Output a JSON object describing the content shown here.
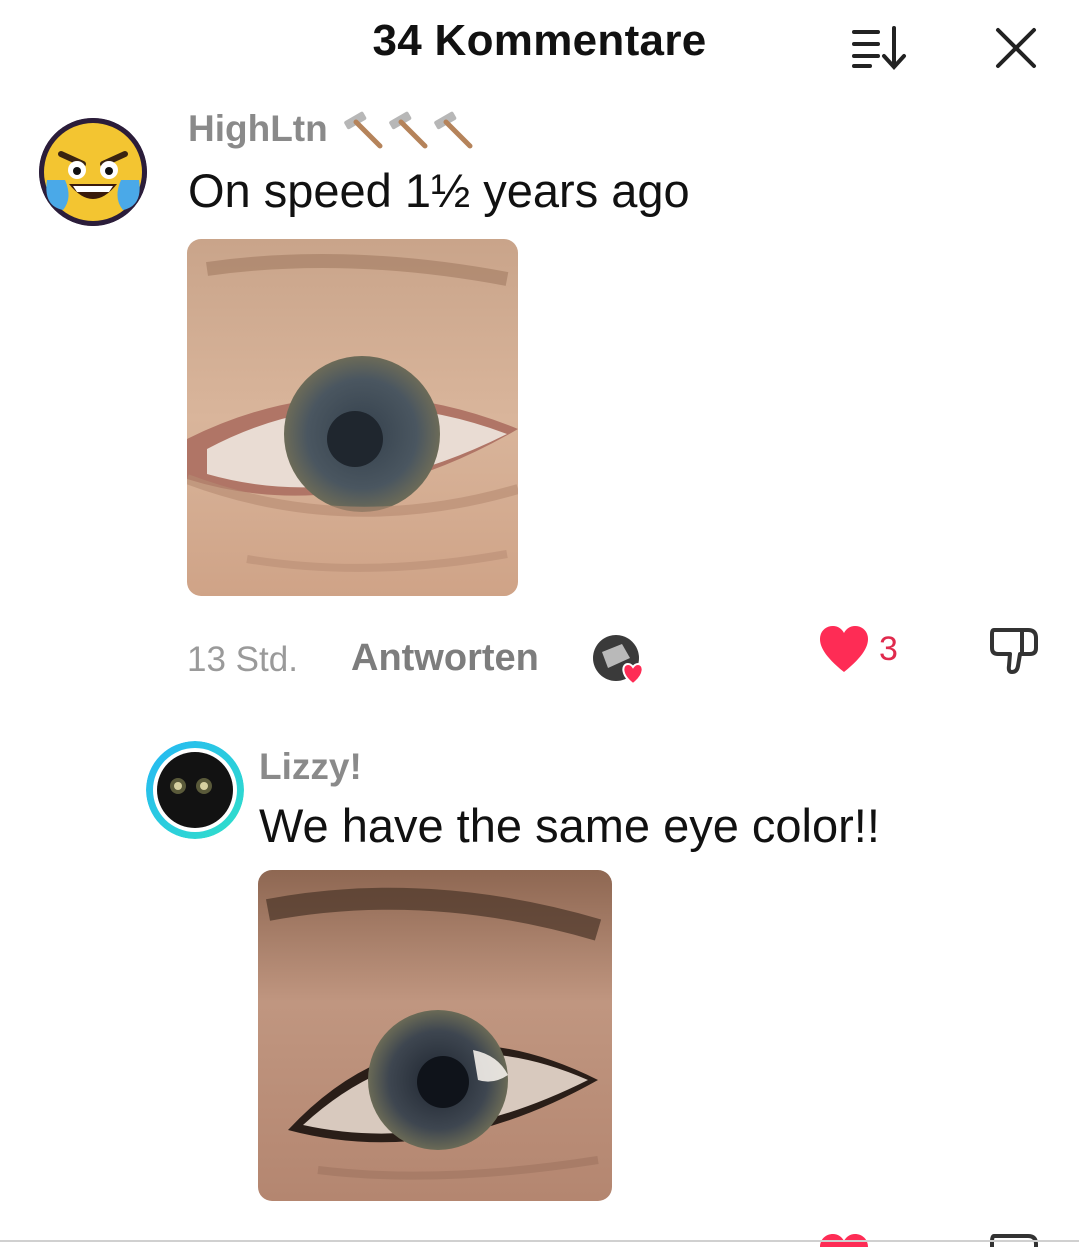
{
  "header": {
    "title": "34 Kommentare"
  },
  "comments": [
    {
      "username": "HighLtn",
      "badge": "hammer-emojis",
      "text": "On speed 1½ years ago",
      "time": "13 Std.",
      "reply_label": "Antworten",
      "likes": "3"
    },
    {
      "username": "Lizzy!",
      "text": "We have the same eye color!!"
    }
  ],
  "colors": {
    "like": "#fe2c55",
    "muted": "#8a8a8a",
    "text": "#111111"
  }
}
